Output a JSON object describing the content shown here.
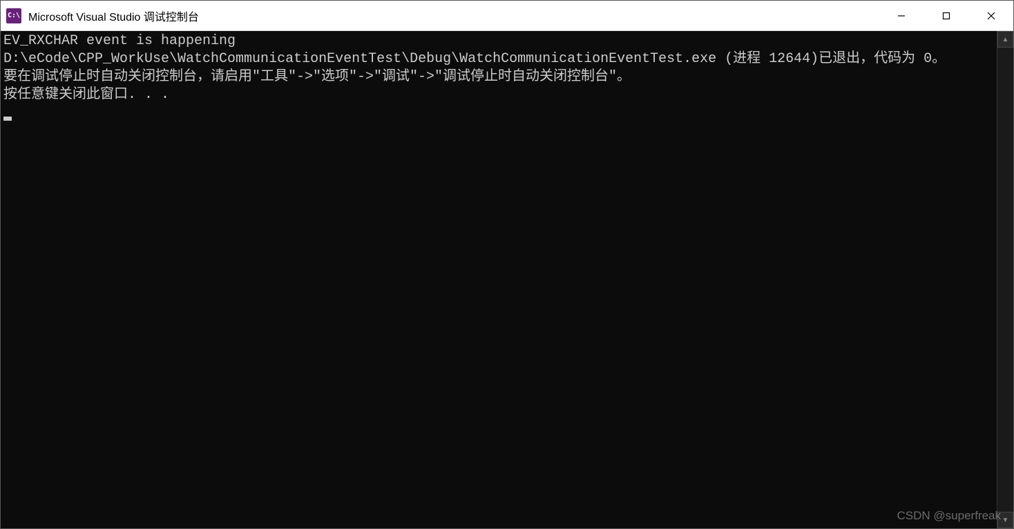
{
  "titlebar": {
    "icon_text": "C:\\",
    "title": "Microsoft Visual Studio 调试控制台"
  },
  "console": {
    "lines": [
      "EV_RXCHAR event is happening",
      "D:\\eCode\\CPP_WorkUse\\WatchCommunicationEventTest\\Debug\\WatchCommunicationEventTest.exe (进程 12644)已退出，代码为 0。",
      "要在调试停止时自动关闭控制台，请启用\"工具\"->\"选项\"->\"调试\"->\"调试停止时自动关闭控制台\"。",
      "按任意键关闭此窗口. . ."
    ]
  },
  "watermark": "CSDN @superfreak"
}
